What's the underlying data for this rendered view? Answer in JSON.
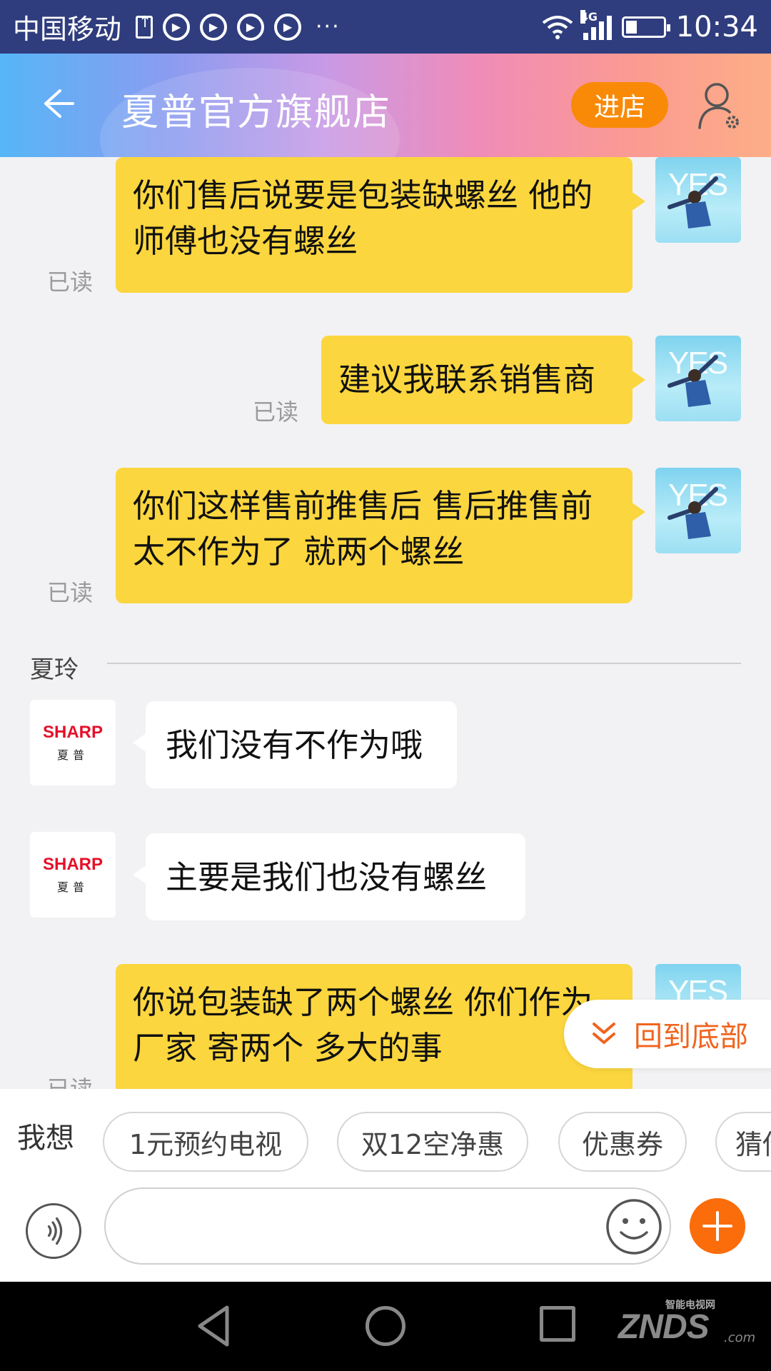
{
  "status_bar": {
    "carrier": "中国移动",
    "dots": "···",
    "network": "4G",
    "time": "10:34"
  },
  "header": {
    "title": "夏普官方旗舰店",
    "enter_store_label": "进店"
  },
  "chat": {
    "messages": [
      {
        "side": "out",
        "text": "你们售后说要是包装缺螺丝  他的师傅也没有螺丝",
        "read": "已读"
      },
      {
        "side": "out",
        "text": "建议我联系销售商",
        "read": "已读"
      },
      {
        "side": "out",
        "text": "你们这样售前推售后  售后推售前  太不作为了  就两个螺丝",
        "read": "已读"
      },
      {
        "side": "in",
        "text": "我们没有不作为哦"
      },
      {
        "side": "in",
        "text": "主要是我们也没有螺丝"
      },
      {
        "side": "out",
        "text": "你说包装缺了两个螺丝  你们作为厂家  寄两个  多大的事",
        "read": "已读"
      }
    ],
    "sender_name": "夏玲",
    "user_avatar_text": "YES",
    "shop_avatar_brand": "SHARP",
    "shop_avatar_cn": "夏普"
  },
  "scroll_bottom_label": "回到底部",
  "quick_bar": {
    "label": "我想",
    "chips": [
      "1元预约电视",
      "双12空净惠",
      "优惠券",
      "猜你"
    ]
  },
  "input": {
    "placeholder": ""
  },
  "watermark": {
    "small": "智能电视网",
    "big": "ZNDS",
    "suffix": ".com"
  },
  "colors": {
    "status_bar": "#2f3d7e",
    "bubble_out": "#fbd63e",
    "accent_orange": "#f98a07",
    "scroll_bottom_text": "#f0641e"
  }
}
